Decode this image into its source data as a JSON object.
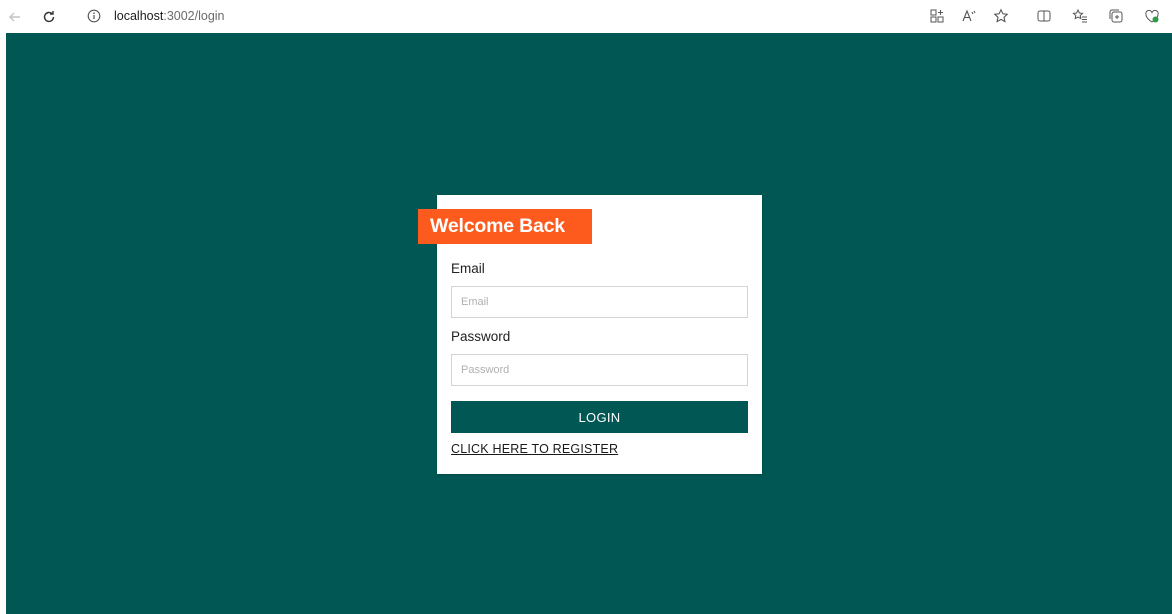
{
  "browser": {
    "url_host": "localhost",
    "url_path": ":3002/login"
  },
  "login_card": {
    "title": "Welcome Back",
    "email_label": "Email",
    "email_placeholder": "Email",
    "email_value": "",
    "password_label": "Password",
    "password_placeholder": "Password",
    "password_value": "",
    "login_button": "LOGIN",
    "register_link": "CLICK HERE TO REGISTER"
  },
  "colors": {
    "page_background": "#015754",
    "accent": "#fd5a1e",
    "button": "#015754"
  },
  "icons": {
    "back": "back-arrow-icon",
    "refresh": "refresh-icon",
    "info": "info-icon",
    "toolbar": [
      "app-grid-icon",
      "read-aloud-icon",
      "favorite-star-icon",
      "split-screen-icon",
      "favorites-list-icon",
      "collections-icon",
      "browser-essentials-icon"
    ]
  }
}
